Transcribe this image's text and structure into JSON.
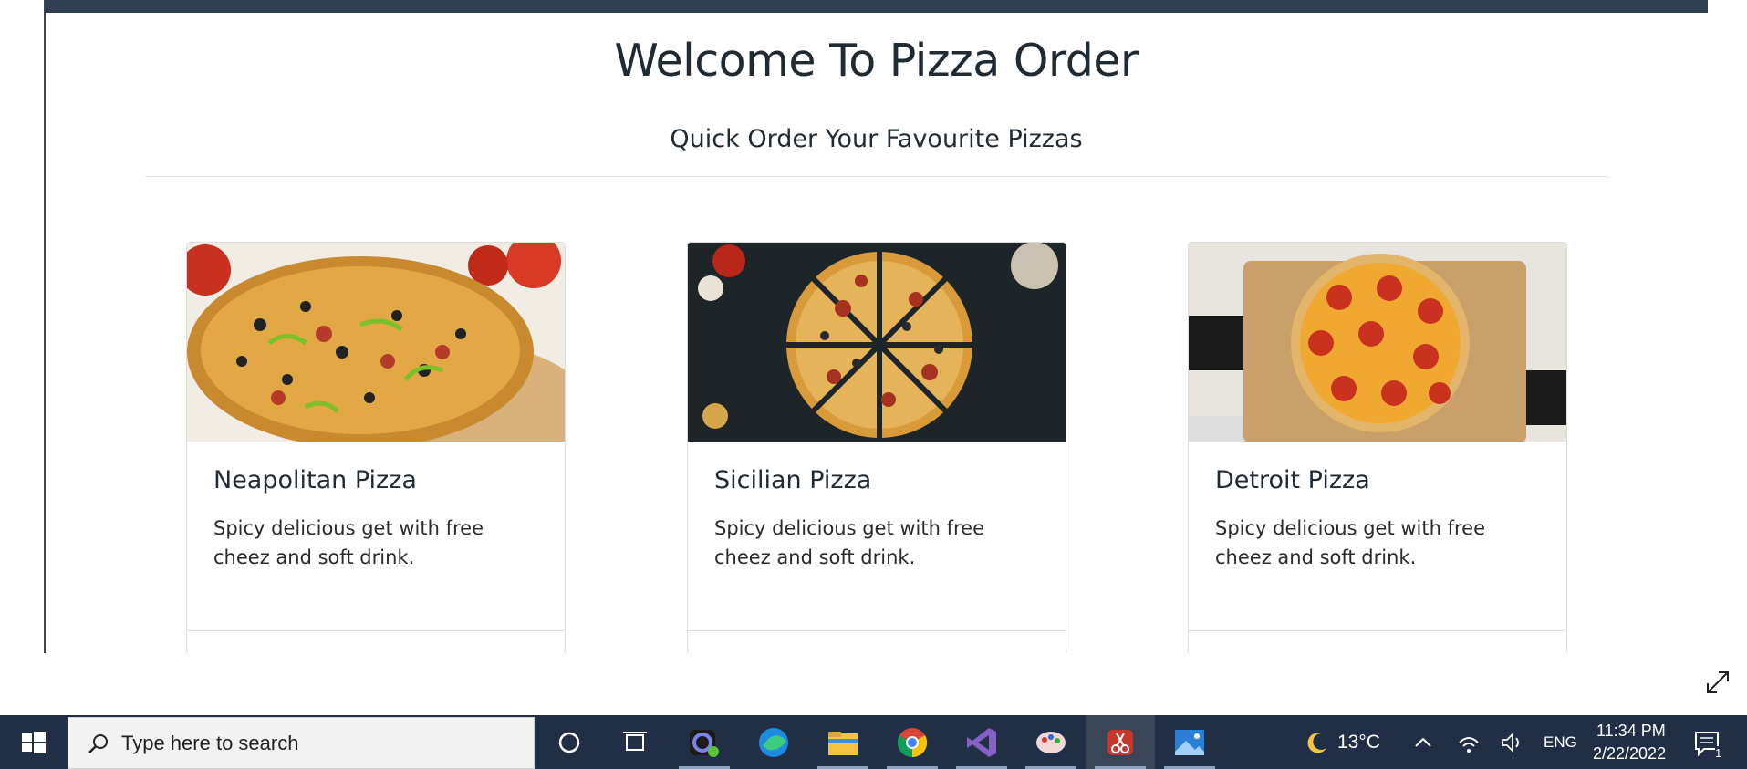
{
  "page": {
    "title": "Welcome To Pizza Order",
    "subtitle": "Quick Order Your Favourite Pizzas"
  },
  "cards": [
    {
      "name": "Neapolitan Pizza",
      "description": "Spicy delicious get with free cheez and soft drink."
    },
    {
      "name": "Sicilian Pizza",
      "description": "Spicy delicious get with free cheez and soft drink."
    },
    {
      "name": "Detroit Pizza",
      "description": "Spicy delicious get with free cheez and soft drink."
    }
  ],
  "taskbar": {
    "search_placeholder": "Type here to search",
    "apps": [
      "cortana-icon",
      "task-view-icon",
      "teams-icon",
      "edge-icon",
      "file-explorer-icon",
      "chrome-icon",
      "visual-studio-icon",
      "paint-icon",
      "snipping-tool-icon",
      "photos-icon"
    ],
    "weather_temp": "13°C",
    "language": "ENG",
    "time": "11:34 PM",
    "date": "2/22/2022",
    "notification_count": "1"
  },
  "colors": {
    "topbar": "#2f3e50",
    "taskbar": "#202f45",
    "text_dark": "#1f2a33"
  }
}
